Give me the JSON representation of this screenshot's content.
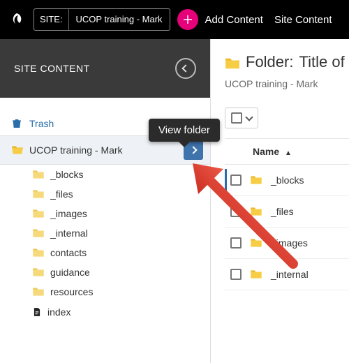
{
  "topbar": {
    "site_label": "SITE:",
    "site_name": "UCOP training - Mark",
    "add_content": "Add Content",
    "site_content": "Site Content"
  },
  "sidebar": {
    "header": "SITE CONTENT",
    "trash": "Trash",
    "root_label": "UCOP training - Mark",
    "children": [
      {
        "label": "_blocks",
        "type": "folder"
      },
      {
        "label": "_files",
        "type": "folder"
      },
      {
        "label": "_images",
        "type": "folder"
      },
      {
        "label": "_internal",
        "type": "folder"
      },
      {
        "label": "contacts",
        "type": "folder"
      },
      {
        "label": "guidance",
        "type": "folder"
      },
      {
        "label": "resources",
        "type": "folder"
      },
      {
        "label": "index",
        "type": "file"
      }
    ]
  },
  "tooltip": "View folder",
  "main": {
    "title_prefix": "Folder:",
    "title_name": "Title of site",
    "breadcrumb": "UCOP training - Mark",
    "name_header": "Name",
    "rows": [
      {
        "label": "_blocks"
      },
      {
        "label": "_files"
      },
      {
        "label": "_images"
      },
      {
        "label": "_internal"
      }
    ]
  }
}
